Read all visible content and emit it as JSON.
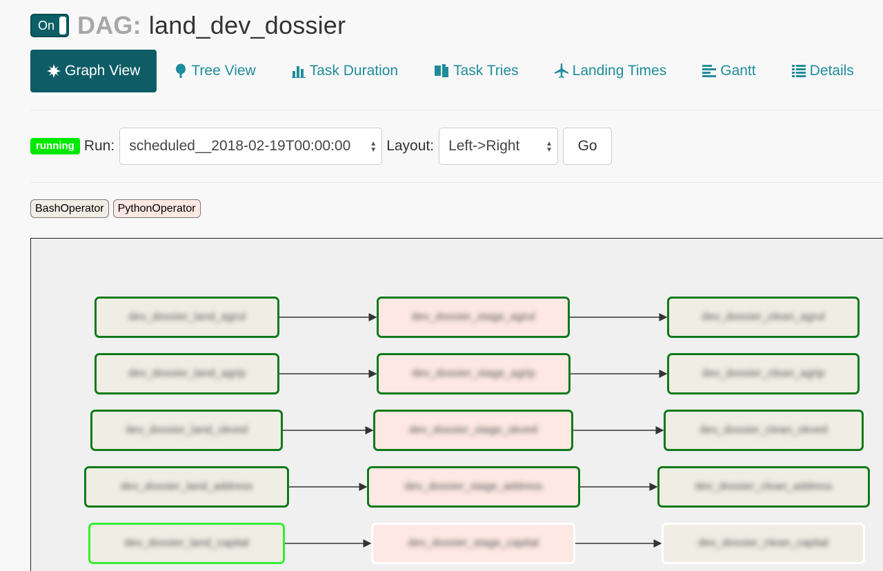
{
  "header": {
    "toggle_label": "On",
    "dag_prefix": "DAG:",
    "dag_id": "land_dev_dossier"
  },
  "nav": {
    "tabs": [
      {
        "label": "Graph View",
        "icon": "asterisk-icon",
        "active": true
      },
      {
        "label": "Tree View",
        "icon": "tree-icon",
        "active": false
      },
      {
        "label": "Task Duration",
        "icon": "stats-icon",
        "active": false
      },
      {
        "label": "Task Tries",
        "icon": "duplicate-icon",
        "active": false
      },
      {
        "label": "Landing Times",
        "icon": "plane-icon",
        "active": false
      },
      {
        "label": "Gantt",
        "icon": "align-left-icon",
        "active": false
      },
      {
        "label": "Details",
        "icon": "list-icon",
        "active": false
      }
    ]
  },
  "controls": {
    "status": "running",
    "run_label": "Run:",
    "run_value": "scheduled__2018-02-19T00:00:00",
    "layout_label": "Layout:",
    "layout_value": "Left->Right",
    "go_label": "Go"
  },
  "legend": {
    "operators": [
      "BashOperator",
      "PythonOperator"
    ]
  },
  "colors": {
    "accent": "#0e5c66",
    "link": "#1f8c9c",
    "running": "#00e800",
    "success_border": "#0e7a1a",
    "running_border": "#33ee33",
    "bash_fill": "#f0ede4",
    "python_fill": "#fde8e3"
  },
  "graph": {
    "rows": [
      {
        "land": "dev_dossier_land_agrul",
        "stage": "dev_dossier_stage_agrul",
        "clean": "dev_dossier_clean_agrul"
      },
      {
        "land": "dev_dossier_land_agrip",
        "stage": "dev_dossier_stage_agrip",
        "clean": "dev_dossier_clean_agrip"
      },
      {
        "land": "dev_dossier_land_okved",
        "stage": "dev_dossier_stage_okved",
        "clean": "dev_dossier_clean_okved"
      },
      {
        "land": "dev_dossier_land_address",
        "stage": "dev_dossier_stage_address",
        "clean": "dev_dossier_clean_address"
      },
      {
        "land": "dev_dossier_land_capital",
        "stage": "dev_dossier_stage_capital",
        "clean": "dev_dossier_clean_capital"
      }
    ]
  }
}
